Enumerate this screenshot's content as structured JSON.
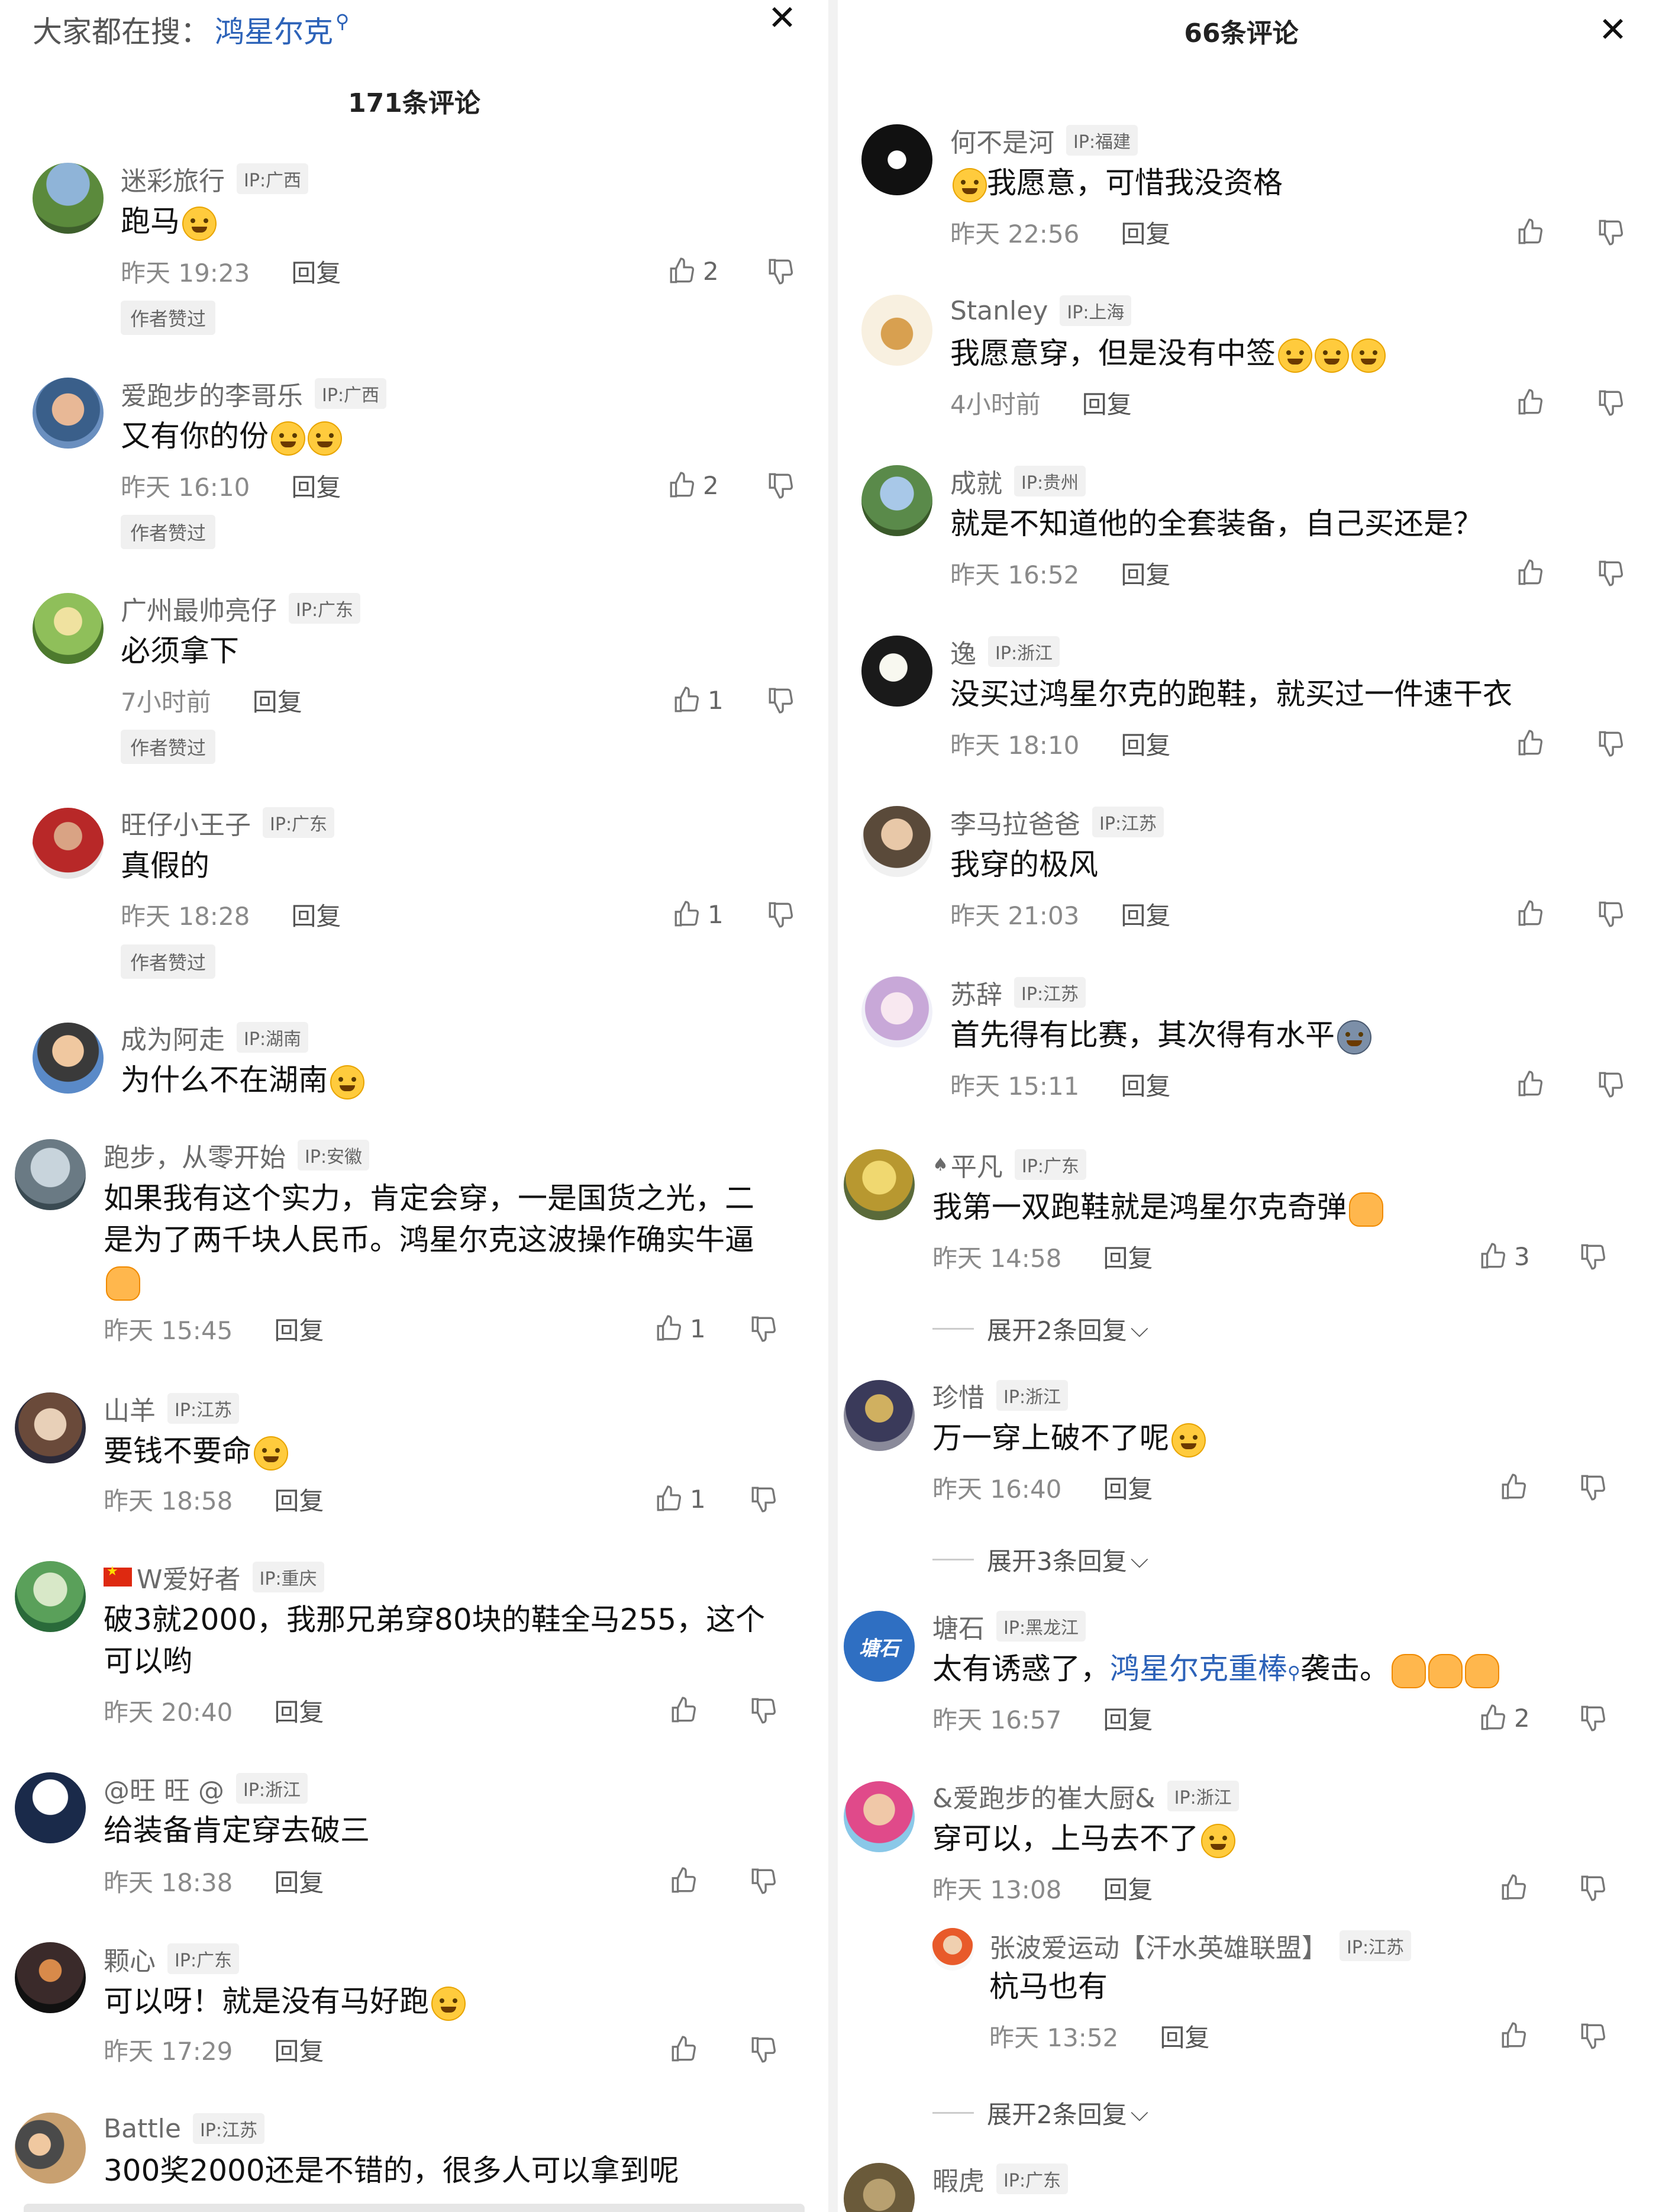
{
  "left": {
    "search": {
      "prefix": "大家都在搜：",
      "keyword": "鸿星尔克"
    },
    "count_title": "171条评论",
    "comments": [
      {
        "name": "迷彩旅行",
        "ip": "IP:广西",
        "text": "跑马",
        "emoji": "face",
        "time": "昨天 19:23",
        "reply": "回复",
        "likes": "2",
        "badge": "作者赞过"
      },
      {
        "name": "爱跑步的李哥乐",
        "ip": "IP:广西",
        "text": "又有你的份",
        "emoji": "face2",
        "time": "昨天 16:10",
        "reply": "回复",
        "likes": "2",
        "badge": "作者赞过"
      },
      {
        "name": "广州最帅亮仔",
        "ip": "IP:广东",
        "text": "必须拿下",
        "time": "7小时前",
        "reply": "回复",
        "likes": "1",
        "badge": "作者赞过"
      },
      {
        "name": "旺仔小王子",
        "ip": "IP:广东",
        "text": "真假的",
        "time": "昨天 18:28",
        "reply": "回复",
        "likes": "1",
        "badge": "作者赞过"
      },
      {
        "name": "成为阿走",
        "ip": "IP:湖南",
        "text": "为什么不在湖南",
        "emoji": "face"
      },
      {
        "name": "跑步，从零开始",
        "ip": "IP:安徽",
        "text": "如果我有这个实力，肯定会穿，一是国货之光，二是为了两千块人民币。鸿星尔克这波操作确实牛逼",
        "emoji": "hand",
        "time": "昨天 15:45",
        "reply": "回复",
        "likes": "1"
      },
      {
        "name": "山羊",
        "ip": "IP:江苏",
        "text": "要钱不要命",
        "emoji": "face",
        "time": "昨天 18:58",
        "reply": "回复",
        "likes": "1"
      },
      {
        "name": "W爱好者",
        "ip": "IP:重庆",
        "text": "破3就2000，我那兄弟穿80块的鞋全马255，这个可以哟",
        "time": "昨天 20:40",
        "reply": "回复"
      },
      {
        "name": "@旺 旺 @",
        "ip": "IP:浙江",
        "text": "给装备肯定穿去破三",
        "time": "昨天 18:38",
        "reply": "回复"
      },
      {
        "name": "颗心",
        "ip": "IP:广东",
        "text": "可以呀！就是没有马好跑",
        "emoji": "face",
        "time": "昨天 17:29",
        "reply": "回复"
      },
      {
        "name": "Battle",
        "ip": "IP:江苏",
        "text": "300奖2000还是不错的，很多人可以拿到呢"
      }
    ]
  },
  "right": {
    "count_title": "66条评论",
    "comments": [
      {
        "name": "何不是河",
        "ip": "IP:福建",
        "text": "我愿意，可惜我没资格",
        "time": "昨天 22:56",
        "reply": "回复"
      },
      {
        "name": "Stanley",
        "ip": "IP:上海",
        "text": "我愿意穿，但是没有中签",
        "time": "4小时前",
        "reply": "回复"
      },
      {
        "name": "成就",
        "ip": "IP:贵州",
        "text": "就是不知道他的全套装备，自己买还是？",
        "time": "昨天 16:52",
        "reply": "回复"
      },
      {
        "name": "逸",
        "ip": "IP:浙江",
        "text": "没买过鸿星尔克的跑鞋，就买过一件速干衣",
        "time": "昨天 18:10",
        "reply": "回复"
      },
      {
        "name": "李马拉爸爸",
        "ip": "IP:江苏",
        "text": "我穿的极风",
        "time": "昨天 21:03",
        "reply": "回复"
      },
      {
        "name": "苏辞",
        "ip": "IP:江苏",
        "text": "首先得有比赛，其次得有水平",
        "time": "昨天 15:11",
        "reply": "回复"
      },
      {
        "name": "平凡",
        "ip": "IP:广东",
        "text": "我第一双跑鞋就是鸿星尔克奇弹",
        "time": "昨天 14:58",
        "reply": "回复",
        "likes": "3",
        "expand": "展开2条回复"
      },
      {
        "name": "珍惜",
        "ip": "IP:浙江",
        "text": "万一穿上破不了呢",
        "time": "昨天 16:40",
        "reply": "回复",
        "expand": "展开3条回复"
      },
      {
        "name": "塘石",
        "ip": "IP:黑龙江",
        "text_pre": "太有诱惑了，",
        "text_link": "鸿星尔克重棒",
        "text_post": "袭击。",
        "time": "昨天 16:57",
        "reply": "回复",
        "likes": "2"
      },
      {
        "name": "&爱跑步的崔大厨&",
        "ip": "IP:浙江",
        "text": "穿可以，上马去不了",
        "time": "昨天 13:08",
        "reply": "回复"
      },
      {
        "name": "张波爱运动【汗水英雄联盟】",
        "ip": "IP:江苏",
        "text": "杭马也有",
        "time": "昨天 13:52",
        "reply": "回复",
        "expand": "展开2条回复"
      },
      {
        "name": "暇虎",
        "ip": "IP:广东"
      }
    ]
  },
  "colors": {
    "link": "#2c62b8",
    "muted": "#8a8a8a",
    "badge_bg": "#f0f0f0"
  }
}
